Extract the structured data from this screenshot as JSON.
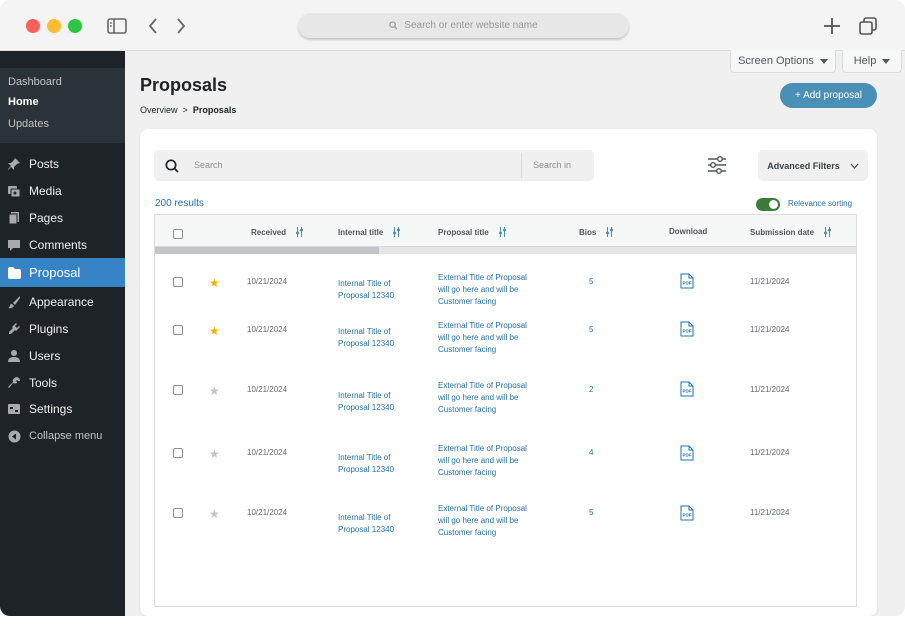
{
  "browser": {
    "address_placeholder": "Search or enter website name"
  },
  "sidebar": {
    "sub_items": [
      {
        "label": "Dashboard",
        "active": false
      },
      {
        "label": "Home",
        "active": true
      },
      {
        "label": "Updates",
        "active": false
      }
    ],
    "items": [
      {
        "label": "Posts",
        "icon": "pin-icon"
      },
      {
        "label": "Media",
        "icon": "media-icon"
      },
      {
        "label": "Pages",
        "icon": "pages-icon"
      },
      {
        "label": "Comments",
        "icon": "comment-icon"
      },
      {
        "label": "Proposal",
        "icon": "folder-icon",
        "current": true
      },
      {
        "label": "Appearance",
        "icon": "brush-icon"
      },
      {
        "label": "Plugins",
        "icon": "plugin-icon"
      },
      {
        "label": "Users",
        "icon": "user-icon"
      },
      {
        "label": "Tools",
        "icon": "wrench-icon"
      },
      {
        "label": "Settings",
        "icon": "settings-icon"
      }
    ],
    "collapse_label": "Collapse menu"
  },
  "top": {
    "screen_options": "Screen Options",
    "help": "Help"
  },
  "page": {
    "title": "Proposals",
    "breadcrumb_root": "Overview",
    "breadcrumb_sep": ">",
    "breadcrumb_current": "Proposals",
    "add_button": "+ Add proposal"
  },
  "toolbar": {
    "search_placeholder": "Search",
    "search_in": "Search in",
    "advanced_filters": "Advanced Filters",
    "results": "200 results",
    "relevance_sorting": "Relevance sorting",
    "relevance_on": true
  },
  "table": {
    "headers": {
      "received": "Received",
      "internal_title": "Internal title",
      "proposal_title": "Proposal title",
      "bios": "Bios",
      "download": "Download",
      "submission_date": "Submission date"
    },
    "scroll_position": 0.32,
    "rows": [
      {
        "starred": true,
        "received": "10/21/2024",
        "internal_1": "Internal Title of",
        "internal_2": "Proposal 12340",
        "prop_1": "External Title of Proposal",
        "prop_2": "will go here and will be",
        "prop_3": "Customer facing",
        "bios": "5",
        "submission": "11/21/2024"
      },
      {
        "starred": true,
        "received": "10/21/2024",
        "internal_1": "Internal Title of",
        "internal_2": "Proposal 12340",
        "prop_1": "External Title of Proposal",
        "prop_2": "will go here and will be",
        "prop_3": "Customer facing",
        "bios": "5",
        "submission": "11/21/2024"
      },
      {
        "starred": false,
        "received": "10/21/2024",
        "internal_1": "Internal Title of",
        "internal_2": "Proposal 12340",
        "prop_1": "External Title of Proposal",
        "prop_2": "will go here and will be",
        "prop_3": "Customer facing",
        "bios": "2",
        "submission": "11/21/2024"
      },
      {
        "starred": false,
        "received": "10/21/2024",
        "internal_1": "Internal Title of",
        "internal_2": "Proposal 12340",
        "prop_1": "External Title of Proposal",
        "prop_2": "will go here and will be",
        "prop_3": "Customer facing",
        "bios": "4",
        "submission": "11/21/2024"
      },
      {
        "starred": false,
        "received": "10/21/2024",
        "internal_1": "Internal Title of",
        "internal_2": "Proposal 12340",
        "prop_1": "External Title of Proposal",
        "prop_2": "will go here and will be",
        "prop_3": "Customer facing",
        "bios": "5",
        "submission": "11/21/2024"
      }
    ],
    "download_icon": "pdf-icon",
    "pdf_label": "PDF"
  },
  "colors": {
    "sidebar_bg": "#1d2327",
    "sidebar_current": "#3582c4",
    "accent_button": "#4a8fb5",
    "link": "#2271b1",
    "star_on": "#f0b400",
    "star_off": "#c3c4c7",
    "toggle_on": "#3a7d3a"
  }
}
